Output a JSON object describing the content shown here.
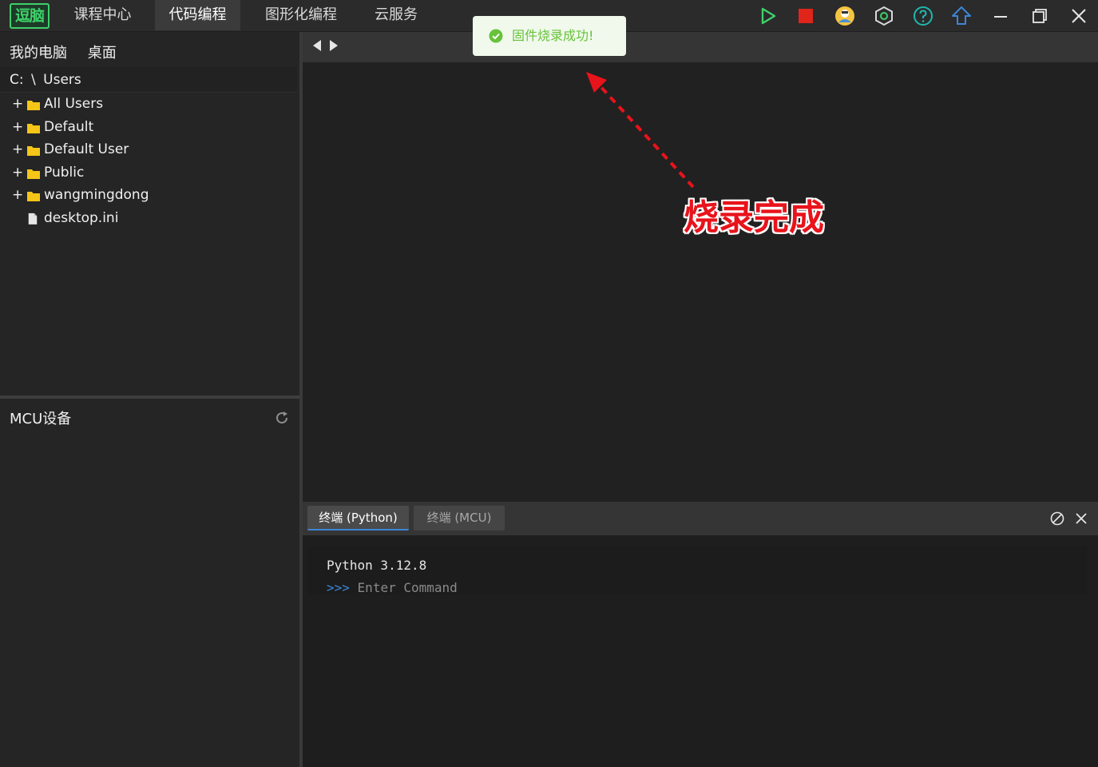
{
  "app": {
    "logo_text": "逗脑",
    "nav_tabs": [
      {
        "label": "课程中心",
        "active": false
      },
      {
        "label": "代码编程",
        "active": true
      },
      {
        "label": "图形化编程",
        "active": false
      },
      {
        "label": "云服务",
        "active": false
      }
    ],
    "toolbar_icons": [
      "run-icon",
      "stop-icon",
      "user-avatar-icon",
      "settings-hex-icon",
      "help-icon",
      "upload-icon",
      "minimize-icon",
      "restore-icon",
      "close-icon"
    ],
    "colors": {
      "accent_green": "#3fd06a",
      "stop_red": "#e0251b",
      "help_cyan": "#1fb8b0",
      "upload_blue": "#3c86d6",
      "toast_bg": "#f0f9eb",
      "toast_text": "#67c23a",
      "annotation_red": "#e8131b"
    }
  },
  "toast": {
    "message": "固件烧录成功!",
    "icon": "check-circle-icon"
  },
  "file_browser": {
    "location_tabs": [
      "我的电脑",
      "桌面"
    ],
    "path": {
      "drive": "C:",
      "separator": "\\",
      "folder": "Users"
    },
    "items": [
      {
        "name": "All Users",
        "type": "folder",
        "expandable": true
      },
      {
        "name": "Default",
        "type": "folder",
        "expandable": true
      },
      {
        "name": "Default User",
        "type": "folder",
        "expandable": true
      },
      {
        "name": "Public",
        "type": "folder",
        "expandable": true
      },
      {
        "name": "wangmingdong",
        "type": "folder",
        "expandable": true
      },
      {
        "name": "desktop.ini",
        "type": "file",
        "expandable": false
      }
    ],
    "expander_symbol": "+"
  },
  "mcu_panel": {
    "title": "MCU设备",
    "refresh_icon": "refresh-icon"
  },
  "annotation": {
    "text": "烧录完成"
  },
  "terminal": {
    "tabs": [
      {
        "label": "终端 (Python)",
        "active": true
      },
      {
        "label": "终端 (MCU)",
        "active": false
      }
    ],
    "version_line": "Python 3.12.8",
    "prompt": ">>>",
    "placeholder": "Enter Command"
  }
}
